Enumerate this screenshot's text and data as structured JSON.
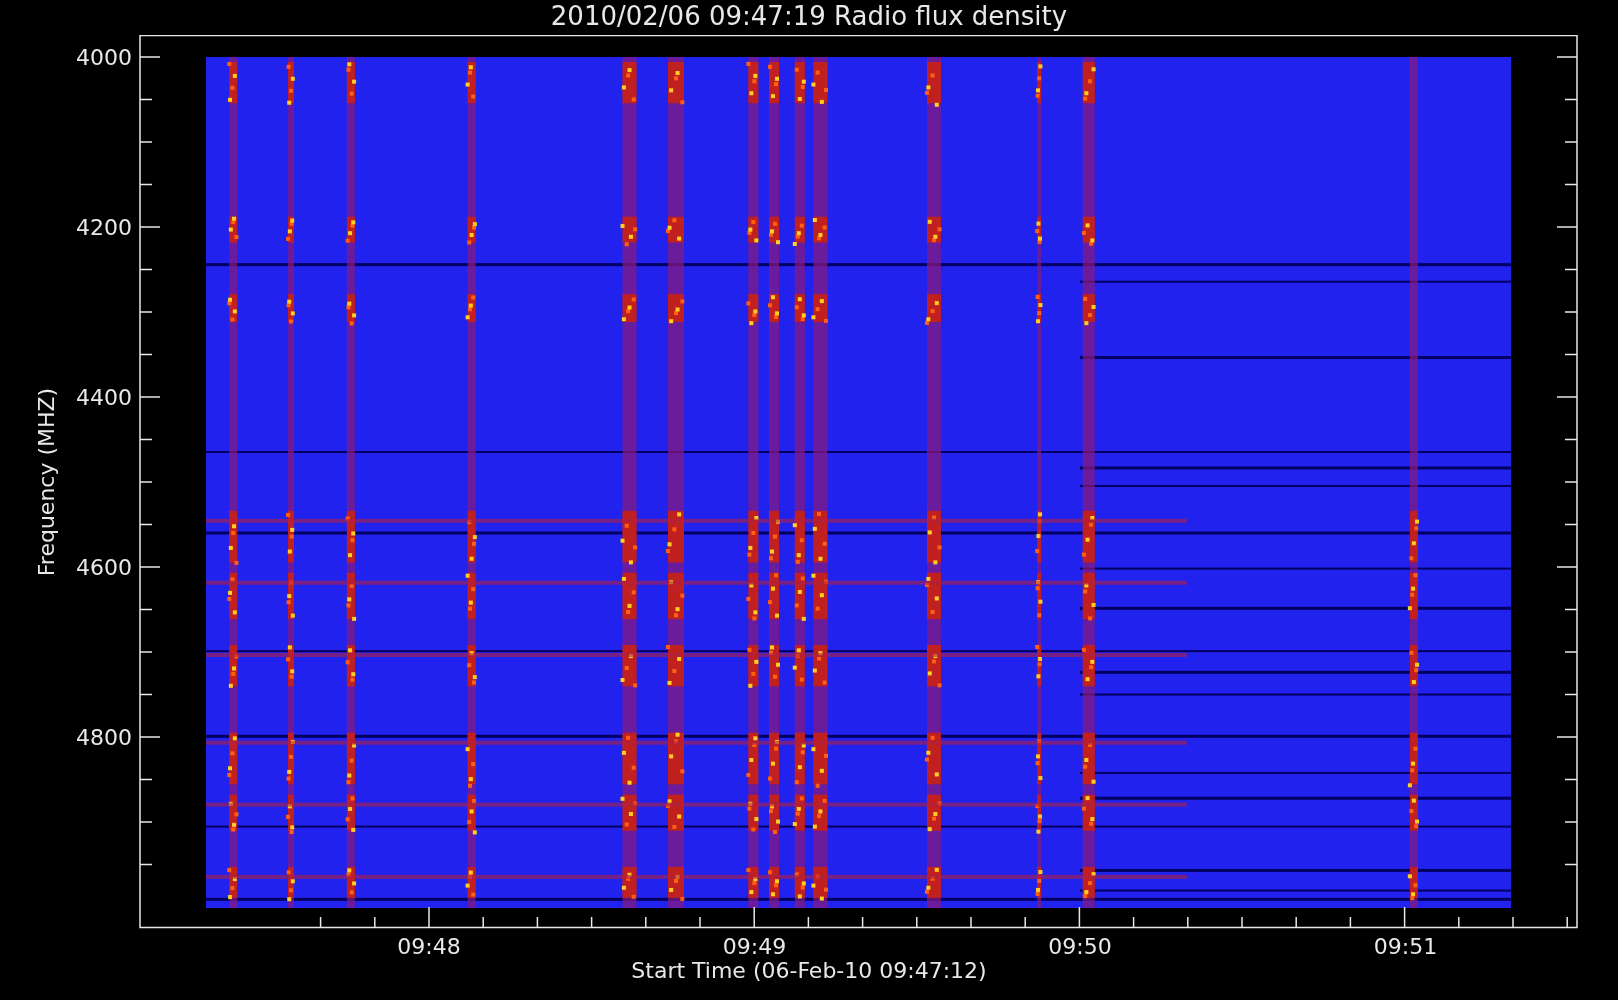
{
  "title": "2010/02/06 09:47:19 Radio flux density",
  "plot": {
    "y_axis": {
      "label": "Frequency (MHZ)",
      "ticks": [
        "4000",
        "4200",
        "4400",
        "4600",
        "4800"
      ]
    },
    "x_axis": {
      "label": "Start Time (06-Feb-10 09:47:12)",
      "ticks": [
        "09:48",
        "09:49",
        "09:50",
        "09:51"
      ]
    }
  }
}
